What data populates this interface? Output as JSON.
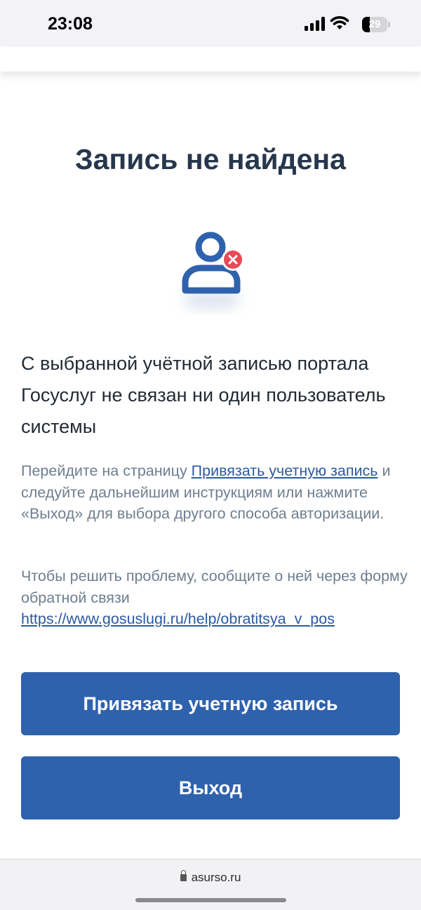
{
  "status_bar": {
    "time": "23:08",
    "battery": "29",
    "icons": [
      "signal-icon",
      "wifi-icon",
      "battery-icon"
    ]
  },
  "page": {
    "title": "Запись не найдена",
    "icon": "user-error-icon",
    "description": "С выбранной учётной записью портала Госуслуг не связан ни один пользователь системы",
    "hint": {
      "before": "Перейдите на страницу ",
      "link": "Привязать учетную запись",
      "after": " и следуйте дальнейшим инструкциям или нажмите «Выход» для выбора другого способа авторизации."
    },
    "help": {
      "text": "Чтобы решить проблему, сообщите о ней через форму обратной связи ",
      "link": "https://www.gosuslugi.ru/help/obratitsya_v_pos"
    }
  },
  "buttons": {
    "link_account": "Привязать учетную запись",
    "exit": "Выход"
  },
  "browser": {
    "address": "asurso.ru"
  },
  "colors": {
    "primary": "#2f62ad",
    "title": "#26374d",
    "error": "#e84a56"
  }
}
